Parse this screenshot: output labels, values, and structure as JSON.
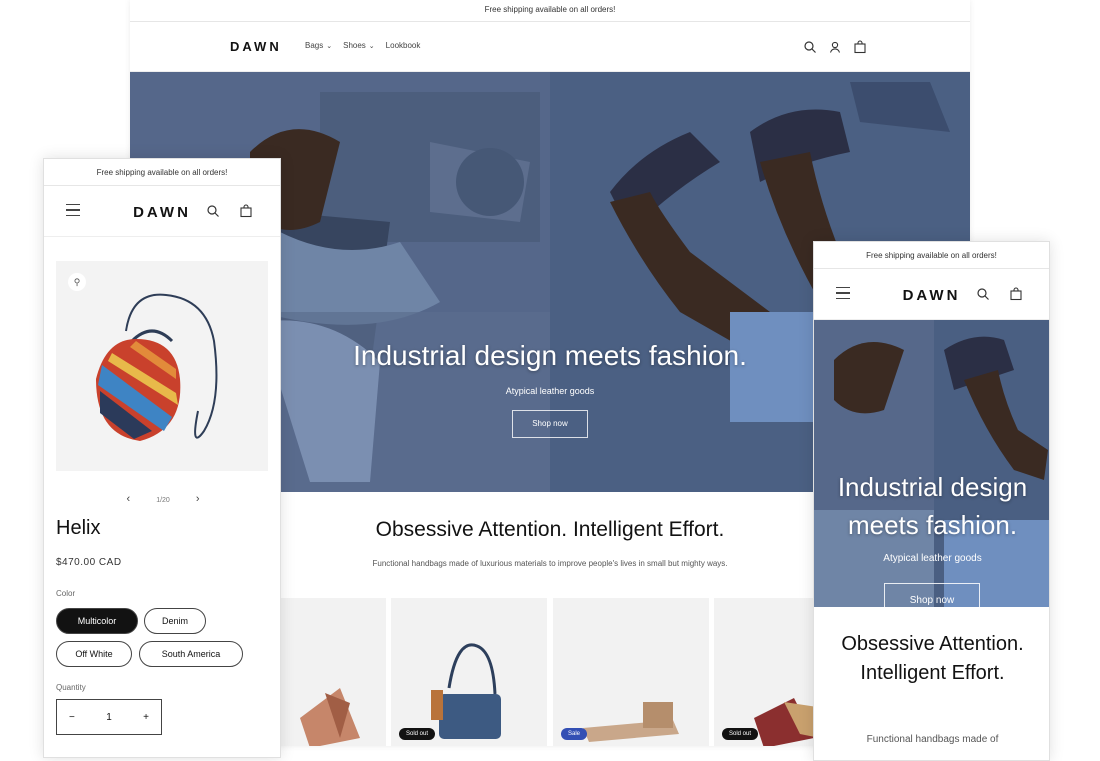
{
  "desktop": {
    "announcement": "Free shipping available on all orders!",
    "logo": "DAWN",
    "nav": [
      {
        "label": "Bags",
        "has_dropdown": true
      },
      {
        "label": "Shoes",
        "has_dropdown": true
      },
      {
        "label": "Lookbook",
        "has_dropdown": false
      }
    ],
    "hero": {
      "title": "Industrial design meets fashion.",
      "subtitle": "Atypical leather goods",
      "button": "Shop now"
    },
    "featured": {
      "title": "Obsessive Attention. Intelligent Effort.",
      "text": "Functional handbags made of luxurious materials to improve people's lives in small but mighty ways."
    },
    "product_badges": [
      "Sold out",
      "Sale",
      "Sold out"
    ]
  },
  "mobile_product": {
    "announcement": "Free shipping available on all orders!",
    "logo": "DAWN",
    "pager": "1/20",
    "name": "Helix",
    "price": "$470.00 CAD",
    "color_label": "Color",
    "colors": [
      "Multicolor",
      "Denim",
      "Off White",
      "South America"
    ],
    "selected_color": "Multicolor",
    "quantity_label": "Quantity",
    "quantity": "1"
  },
  "mobile_home": {
    "announcement": "Free shipping available on all orders!",
    "logo": "DAWN",
    "hero_title": "Industrial design meets fashion.",
    "hero_subtitle": "Atypical leather goods",
    "hero_button": "Shop now",
    "featured_title": "Obsessive Attention. Intelligent Effort.",
    "featured_text": "Functional handbags made of"
  },
  "colors": {
    "hero_blue": "#485a77",
    "text_dark": "#121212",
    "badge_dark": "#121212",
    "badge_sale": "#334fb4"
  }
}
